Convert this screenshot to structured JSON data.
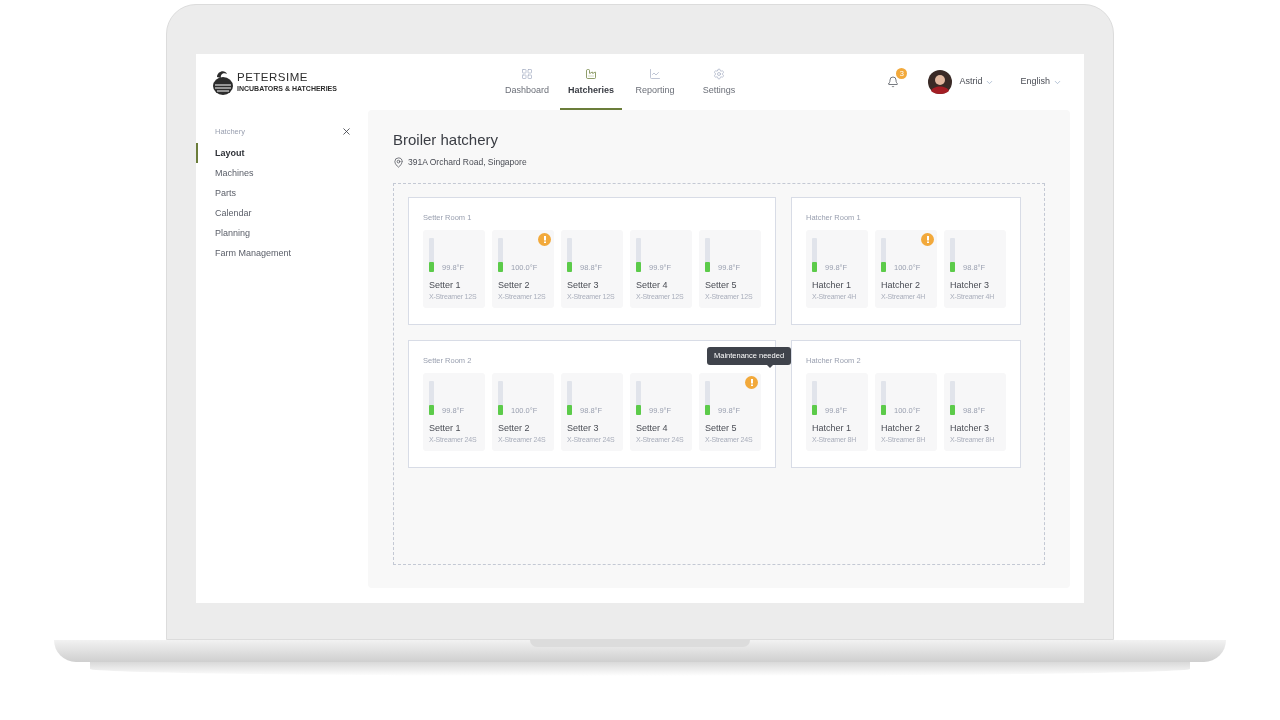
{
  "header": {
    "logo": {
      "name": "PETERSIME",
      "tagline": "INCUBATORS & HATCHERIES"
    },
    "tabs": [
      {
        "label": "Dashboard",
        "kind": "grid",
        "selected": false
      },
      {
        "label": "Hatcheries",
        "kind": "factory",
        "selected": true
      },
      {
        "label": "Reporting",
        "kind": "chart",
        "selected": false
      },
      {
        "label": "Settings",
        "kind": "gear",
        "selected": false
      }
    ],
    "notifications": {
      "count": "3"
    },
    "user": {
      "name": "Astrid"
    },
    "language": "English"
  },
  "sidebar": {
    "title": "Hatchery",
    "items": [
      {
        "label": "Layout",
        "selected": true
      },
      {
        "label": "Machines",
        "selected": false
      },
      {
        "label": "Parts",
        "selected": false
      },
      {
        "label": "Calendar",
        "selected": false
      },
      {
        "label": "Planning",
        "selected": false
      },
      {
        "label": "Farm Management",
        "selected": false
      }
    ]
  },
  "main": {
    "title": "Broiler hatchery",
    "address": "391A Orchard Road, Singapore",
    "rooms": [
      {
        "name": "Setter Room 1",
        "machines": [
          {
            "name": "Setter 1",
            "model": "X-Streamer 12S",
            "temperature": "99.8°F",
            "level": 0.3,
            "alert": false
          },
          {
            "name": "Setter 2",
            "model": "X-Streamer 12S",
            "temperature": "100.0°F",
            "level": 0.3,
            "alert": true
          },
          {
            "name": "Setter 3",
            "model": "X-Streamer 12S",
            "temperature": "98.8°F",
            "level": 0.3,
            "alert": false
          },
          {
            "name": "Setter 4",
            "model": "X-Streamer 12S",
            "temperature": "99.9°F",
            "level": 0.3,
            "alert": false
          },
          {
            "name": "Setter 5",
            "model": "X-Streamer 12S",
            "temperature": "99.8°F",
            "level": 0.3,
            "alert": false
          }
        ]
      },
      {
        "name": "Hatcher Room 1",
        "machines": [
          {
            "name": "Hatcher 1",
            "model": "X-Streamer 4H",
            "temperature": "99.8°F",
            "level": 0.3,
            "alert": false
          },
          {
            "name": "Hatcher 2",
            "model": "X-Streamer 4H",
            "temperature": "100.0°F",
            "level": 0.3,
            "alert": true
          },
          {
            "name": "Hatcher 3",
            "model": "X-Streamer 4H",
            "temperature": "98.8°F",
            "level": 0.3,
            "alert": false
          }
        ]
      },
      {
        "name": "Setter Room 2",
        "machines": [
          {
            "name": "Setter 1",
            "model": "X-Streamer 24S",
            "temperature": "99.8°F",
            "level": 0.3,
            "alert": false
          },
          {
            "name": "Setter 2",
            "model": "X-Streamer 24S",
            "temperature": "100.0°F",
            "level": 0.3,
            "alert": false
          },
          {
            "name": "Setter 3",
            "model": "X-Streamer 24S",
            "temperature": "98.8°F",
            "level": 0.3,
            "alert": false
          },
          {
            "name": "Setter 4",
            "model": "X-Streamer 24S",
            "temperature": "99.9°F",
            "level": 0.3,
            "alert": false
          },
          {
            "name": "Setter 5",
            "model": "X-Streamer 24S",
            "temperature": "99.8°F",
            "level": 0.3,
            "alert": true,
            "tooltip": "Maintenance needed"
          }
        ]
      },
      {
        "name": "Hatcher Room 2",
        "machines": [
          {
            "name": "Hatcher 1",
            "model": "X-Streamer 8H",
            "temperature": "99.8°F",
            "level": 0.3,
            "alert": false
          },
          {
            "name": "Hatcher 2",
            "model": "X-Streamer 8H",
            "temperature": "100.0°F",
            "level": 0.3,
            "alert": false
          },
          {
            "name": "Hatcher 3",
            "model": "X-Streamer 8H",
            "temperature": "98.8°F",
            "level": 0.3,
            "alert": false
          }
        ]
      }
    ]
  }
}
